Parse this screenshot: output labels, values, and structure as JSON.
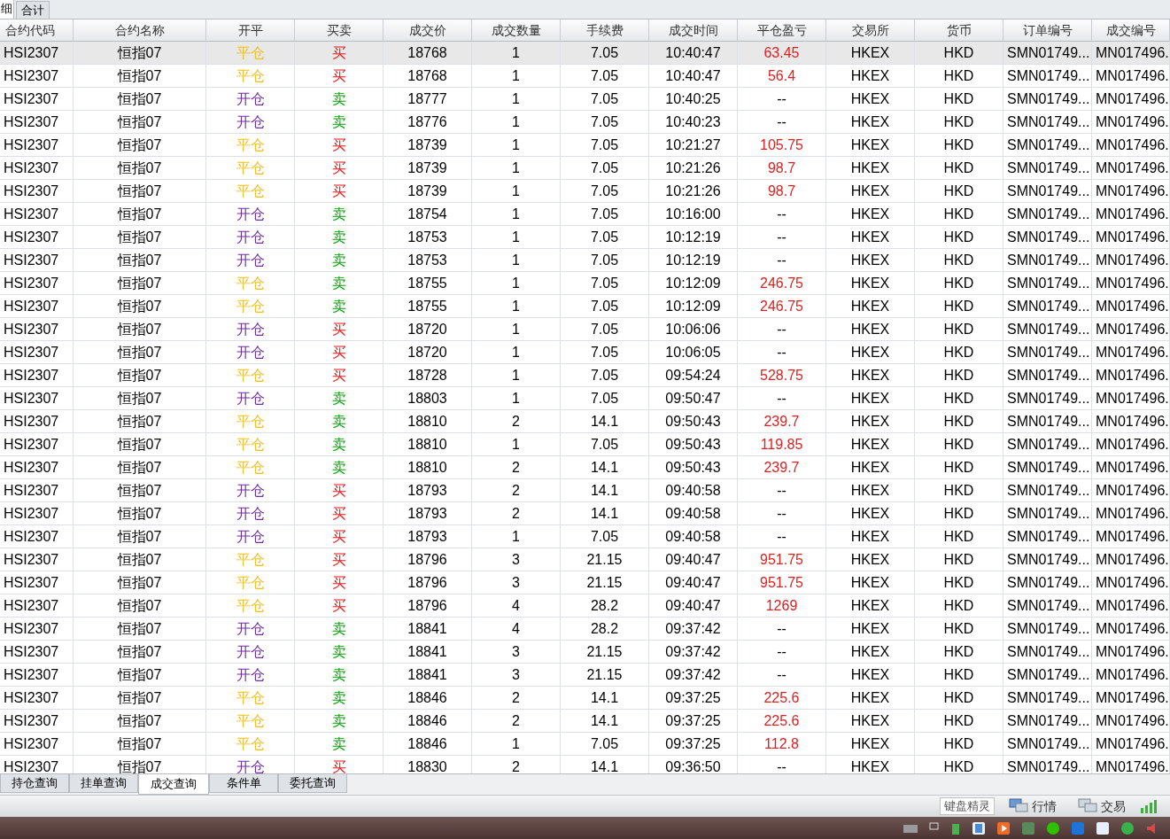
{
  "top_tabs": [
    {
      "label": "细",
      "selected": true
    },
    {
      "label": "合计",
      "selected": false
    }
  ],
  "table": {
    "columns": [
      "合约代码",
      "合约名称",
      "开平",
      "买卖",
      "成交价",
      "成交数量",
      "手续费",
      "成交时间",
      "平仓盈亏",
      "交易所",
      "货币",
      "订单编号",
      "成交编号"
    ],
    "rows": [
      {
        "selected": true,
        "code": "HSI2307",
        "name": "恒指07",
        "open_close": {
          "text": "平仓",
          "color": "#f0c020"
        },
        "side": {
          "text": "买",
          "color": "#e02020"
        },
        "price": "18768",
        "qty": "1",
        "fee": "7.05",
        "time": "10:40:47",
        "pnl": {
          "text": "63.45",
          "color": "#e02020"
        },
        "exchange": "HKEX",
        "currency": "HKD",
        "order_no": "SMN01749...",
        "trade_no": "MN017496."
      },
      {
        "selected": false,
        "code": "HSI2307",
        "name": "恒指07",
        "open_close": {
          "text": "平仓",
          "color": "#f0c020"
        },
        "side": {
          "text": "买",
          "color": "#e02020"
        },
        "price": "18768",
        "qty": "1",
        "fee": "7.05",
        "time": "10:40:47",
        "pnl": {
          "text": "56.4",
          "color": "#e02020"
        },
        "exchange": "HKEX",
        "currency": "HKD",
        "order_no": "SMN01749...",
        "trade_no": "MN017496."
      },
      {
        "selected": false,
        "code": "HSI2307",
        "name": "恒指07",
        "open_close": {
          "text": "开仓",
          "color": "#7030a0"
        },
        "side": {
          "text": "卖",
          "color": "#10a010"
        },
        "price": "18777",
        "qty": "1",
        "fee": "7.05",
        "time": "10:40:25",
        "pnl": {
          "text": "--",
          "color": "#000000"
        },
        "exchange": "HKEX",
        "currency": "HKD",
        "order_no": "SMN01749...",
        "trade_no": "MN017496."
      },
      {
        "selected": false,
        "code": "HSI2307",
        "name": "恒指07",
        "open_close": {
          "text": "开仓",
          "color": "#7030a0"
        },
        "side": {
          "text": "卖",
          "color": "#10a010"
        },
        "price": "18776",
        "qty": "1",
        "fee": "7.05",
        "time": "10:40:23",
        "pnl": {
          "text": "--",
          "color": "#000000"
        },
        "exchange": "HKEX",
        "currency": "HKD",
        "order_no": "SMN01749...",
        "trade_no": "MN017496."
      },
      {
        "selected": false,
        "code": "HSI2307",
        "name": "恒指07",
        "open_close": {
          "text": "平仓",
          "color": "#f0c020"
        },
        "side": {
          "text": "买",
          "color": "#e02020"
        },
        "price": "18739",
        "qty": "1",
        "fee": "7.05",
        "time": "10:21:27",
        "pnl": {
          "text": "105.75",
          "color": "#e02020"
        },
        "exchange": "HKEX",
        "currency": "HKD",
        "order_no": "SMN01749...",
        "trade_no": "MN017496."
      },
      {
        "selected": false,
        "code": "HSI2307",
        "name": "恒指07",
        "open_close": {
          "text": "平仓",
          "color": "#f0c020"
        },
        "side": {
          "text": "买",
          "color": "#e02020"
        },
        "price": "18739",
        "qty": "1",
        "fee": "7.05",
        "time": "10:21:26",
        "pnl": {
          "text": "98.7",
          "color": "#e02020"
        },
        "exchange": "HKEX",
        "currency": "HKD",
        "order_no": "SMN01749...",
        "trade_no": "MN017496."
      },
      {
        "selected": false,
        "code": "HSI2307",
        "name": "恒指07",
        "open_close": {
          "text": "平仓",
          "color": "#f0c020"
        },
        "side": {
          "text": "买",
          "color": "#e02020"
        },
        "price": "18739",
        "qty": "1",
        "fee": "7.05",
        "time": "10:21:26",
        "pnl": {
          "text": "98.7",
          "color": "#e02020"
        },
        "exchange": "HKEX",
        "currency": "HKD",
        "order_no": "SMN01749...",
        "trade_no": "MN017496."
      },
      {
        "selected": false,
        "code": "HSI2307",
        "name": "恒指07",
        "open_close": {
          "text": "开仓",
          "color": "#7030a0"
        },
        "side": {
          "text": "卖",
          "color": "#10a010"
        },
        "price": "18754",
        "qty": "1",
        "fee": "7.05",
        "time": "10:16:00",
        "pnl": {
          "text": "--",
          "color": "#000000"
        },
        "exchange": "HKEX",
        "currency": "HKD",
        "order_no": "SMN01749...",
        "trade_no": "MN017496."
      },
      {
        "selected": false,
        "code": "HSI2307",
        "name": "恒指07",
        "open_close": {
          "text": "开仓",
          "color": "#7030a0"
        },
        "side": {
          "text": "卖",
          "color": "#10a010"
        },
        "price": "18753",
        "qty": "1",
        "fee": "7.05",
        "time": "10:12:19",
        "pnl": {
          "text": "--",
          "color": "#000000"
        },
        "exchange": "HKEX",
        "currency": "HKD",
        "order_no": "SMN01749...",
        "trade_no": "MN017496."
      },
      {
        "selected": false,
        "code": "HSI2307",
        "name": "恒指07",
        "open_close": {
          "text": "开仓",
          "color": "#7030a0"
        },
        "side": {
          "text": "卖",
          "color": "#10a010"
        },
        "price": "18753",
        "qty": "1",
        "fee": "7.05",
        "time": "10:12:19",
        "pnl": {
          "text": "--",
          "color": "#000000"
        },
        "exchange": "HKEX",
        "currency": "HKD",
        "order_no": "SMN01749...",
        "trade_no": "MN017496."
      },
      {
        "selected": false,
        "code": "HSI2307",
        "name": "恒指07",
        "open_close": {
          "text": "平仓",
          "color": "#f0c020"
        },
        "side": {
          "text": "卖",
          "color": "#10a010"
        },
        "price": "18755",
        "qty": "1",
        "fee": "7.05",
        "time": "10:12:09",
        "pnl": {
          "text": "246.75",
          "color": "#e02020"
        },
        "exchange": "HKEX",
        "currency": "HKD",
        "order_no": "SMN01749...",
        "trade_no": "MN017496."
      },
      {
        "selected": false,
        "code": "HSI2307",
        "name": "恒指07",
        "open_close": {
          "text": "平仓",
          "color": "#f0c020"
        },
        "side": {
          "text": "卖",
          "color": "#10a010"
        },
        "price": "18755",
        "qty": "1",
        "fee": "7.05",
        "time": "10:12:09",
        "pnl": {
          "text": "246.75",
          "color": "#e02020"
        },
        "exchange": "HKEX",
        "currency": "HKD",
        "order_no": "SMN01749...",
        "trade_no": "MN017496."
      },
      {
        "selected": false,
        "code": "HSI2307",
        "name": "恒指07",
        "open_close": {
          "text": "开仓",
          "color": "#7030a0"
        },
        "side": {
          "text": "买",
          "color": "#e02020"
        },
        "price": "18720",
        "qty": "1",
        "fee": "7.05",
        "time": "10:06:06",
        "pnl": {
          "text": "--",
          "color": "#000000"
        },
        "exchange": "HKEX",
        "currency": "HKD",
        "order_no": "SMN01749...",
        "trade_no": "MN017496."
      },
      {
        "selected": false,
        "code": "HSI2307",
        "name": "恒指07",
        "open_close": {
          "text": "开仓",
          "color": "#7030a0"
        },
        "side": {
          "text": "买",
          "color": "#e02020"
        },
        "price": "18720",
        "qty": "1",
        "fee": "7.05",
        "time": "10:06:05",
        "pnl": {
          "text": "--",
          "color": "#000000"
        },
        "exchange": "HKEX",
        "currency": "HKD",
        "order_no": "SMN01749...",
        "trade_no": "MN017496."
      },
      {
        "selected": false,
        "code": "HSI2307",
        "name": "恒指07",
        "open_close": {
          "text": "平仓",
          "color": "#f0c020"
        },
        "side": {
          "text": "买",
          "color": "#e02020"
        },
        "price": "18728",
        "qty": "1",
        "fee": "7.05",
        "time": "09:54:24",
        "pnl": {
          "text": "528.75",
          "color": "#e02020"
        },
        "exchange": "HKEX",
        "currency": "HKD",
        "order_no": "SMN01749...",
        "trade_no": "MN017496."
      },
      {
        "selected": false,
        "code": "HSI2307",
        "name": "恒指07",
        "open_close": {
          "text": "开仓",
          "color": "#7030a0"
        },
        "side": {
          "text": "卖",
          "color": "#10a010"
        },
        "price": "18803",
        "qty": "1",
        "fee": "7.05",
        "time": "09:50:47",
        "pnl": {
          "text": "--",
          "color": "#000000"
        },
        "exchange": "HKEX",
        "currency": "HKD",
        "order_no": "SMN01749...",
        "trade_no": "MN017496."
      },
      {
        "selected": false,
        "code": "HSI2307",
        "name": "恒指07",
        "open_close": {
          "text": "平仓",
          "color": "#f0c020"
        },
        "side": {
          "text": "卖",
          "color": "#10a010"
        },
        "price": "18810",
        "qty": "2",
        "fee": "14.1",
        "time": "09:50:43",
        "pnl": {
          "text": "239.7",
          "color": "#e02020"
        },
        "exchange": "HKEX",
        "currency": "HKD",
        "order_no": "SMN01749...",
        "trade_no": "MN017496."
      },
      {
        "selected": false,
        "code": "HSI2307",
        "name": "恒指07",
        "open_close": {
          "text": "平仓",
          "color": "#f0c020"
        },
        "side": {
          "text": "卖",
          "color": "#10a010"
        },
        "price": "18810",
        "qty": "1",
        "fee": "7.05",
        "time": "09:50:43",
        "pnl": {
          "text": "119.85",
          "color": "#e02020"
        },
        "exchange": "HKEX",
        "currency": "HKD",
        "order_no": "SMN01749...",
        "trade_no": "MN017496."
      },
      {
        "selected": false,
        "code": "HSI2307",
        "name": "恒指07",
        "open_close": {
          "text": "平仓",
          "color": "#f0c020"
        },
        "side": {
          "text": "卖",
          "color": "#10a010"
        },
        "price": "18810",
        "qty": "2",
        "fee": "14.1",
        "time": "09:50:43",
        "pnl": {
          "text": "239.7",
          "color": "#e02020"
        },
        "exchange": "HKEX",
        "currency": "HKD",
        "order_no": "SMN01749...",
        "trade_no": "MN017496."
      },
      {
        "selected": false,
        "code": "HSI2307",
        "name": "恒指07",
        "open_close": {
          "text": "开仓",
          "color": "#7030a0"
        },
        "side": {
          "text": "买",
          "color": "#e02020"
        },
        "price": "18793",
        "qty": "2",
        "fee": "14.1",
        "time": "09:40:58",
        "pnl": {
          "text": "--",
          "color": "#000000"
        },
        "exchange": "HKEX",
        "currency": "HKD",
        "order_no": "SMN01749...",
        "trade_no": "MN017496."
      },
      {
        "selected": false,
        "code": "HSI2307",
        "name": "恒指07",
        "open_close": {
          "text": "开仓",
          "color": "#7030a0"
        },
        "side": {
          "text": "买",
          "color": "#e02020"
        },
        "price": "18793",
        "qty": "2",
        "fee": "14.1",
        "time": "09:40:58",
        "pnl": {
          "text": "--",
          "color": "#000000"
        },
        "exchange": "HKEX",
        "currency": "HKD",
        "order_no": "SMN01749...",
        "trade_no": "MN017496."
      },
      {
        "selected": false,
        "code": "HSI2307",
        "name": "恒指07",
        "open_close": {
          "text": "开仓",
          "color": "#7030a0"
        },
        "side": {
          "text": "买",
          "color": "#e02020"
        },
        "price": "18793",
        "qty": "1",
        "fee": "7.05",
        "time": "09:40:58",
        "pnl": {
          "text": "--",
          "color": "#000000"
        },
        "exchange": "HKEX",
        "currency": "HKD",
        "order_no": "SMN01749...",
        "trade_no": "MN017496."
      },
      {
        "selected": false,
        "code": "HSI2307",
        "name": "恒指07",
        "open_close": {
          "text": "平仓",
          "color": "#f0c020"
        },
        "side": {
          "text": "买",
          "color": "#e02020"
        },
        "price": "18796",
        "qty": "3",
        "fee": "21.15",
        "time": "09:40:47",
        "pnl": {
          "text": "951.75",
          "color": "#e02020"
        },
        "exchange": "HKEX",
        "currency": "HKD",
        "order_no": "SMN01749...",
        "trade_no": "MN017496."
      },
      {
        "selected": false,
        "code": "HSI2307",
        "name": "恒指07",
        "open_close": {
          "text": "平仓",
          "color": "#f0c020"
        },
        "side": {
          "text": "买",
          "color": "#e02020"
        },
        "price": "18796",
        "qty": "3",
        "fee": "21.15",
        "time": "09:40:47",
        "pnl": {
          "text": "951.75",
          "color": "#e02020"
        },
        "exchange": "HKEX",
        "currency": "HKD",
        "order_no": "SMN01749...",
        "trade_no": "MN017496."
      },
      {
        "selected": false,
        "code": "HSI2307",
        "name": "恒指07",
        "open_close": {
          "text": "平仓",
          "color": "#f0c020"
        },
        "side": {
          "text": "买",
          "color": "#e02020"
        },
        "price": "18796",
        "qty": "4",
        "fee": "28.2",
        "time": "09:40:47",
        "pnl": {
          "text": "1269",
          "color": "#e02020"
        },
        "exchange": "HKEX",
        "currency": "HKD",
        "order_no": "SMN01749...",
        "trade_no": "MN017496."
      },
      {
        "selected": false,
        "code": "HSI2307",
        "name": "恒指07",
        "open_close": {
          "text": "开仓",
          "color": "#7030a0"
        },
        "side": {
          "text": "卖",
          "color": "#10a010"
        },
        "price": "18841",
        "qty": "4",
        "fee": "28.2",
        "time": "09:37:42",
        "pnl": {
          "text": "--",
          "color": "#000000"
        },
        "exchange": "HKEX",
        "currency": "HKD",
        "order_no": "SMN01749...",
        "trade_no": "MN017496."
      },
      {
        "selected": false,
        "code": "HSI2307",
        "name": "恒指07",
        "open_close": {
          "text": "开仓",
          "color": "#7030a0"
        },
        "side": {
          "text": "卖",
          "color": "#10a010"
        },
        "price": "18841",
        "qty": "3",
        "fee": "21.15",
        "time": "09:37:42",
        "pnl": {
          "text": "--",
          "color": "#000000"
        },
        "exchange": "HKEX",
        "currency": "HKD",
        "order_no": "SMN01749...",
        "trade_no": "MN017496."
      },
      {
        "selected": false,
        "code": "HSI2307",
        "name": "恒指07",
        "open_close": {
          "text": "开仓",
          "color": "#7030a0"
        },
        "side": {
          "text": "卖",
          "color": "#10a010"
        },
        "price": "18841",
        "qty": "3",
        "fee": "21.15",
        "time": "09:37:42",
        "pnl": {
          "text": "--",
          "color": "#000000"
        },
        "exchange": "HKEX",
        "currency": "HKD",
        "order_no": "SMN01749...",
        "trade_no": "MN017496."
      },
      {
        "selected": false,
        "code": "HSI2307",
        "name": "恒指07",
        "open_close": {
          "text": "平仓",
          "color": "#f0c020"
        },
        "side": {
          "text": "卖",
          "color": "#10a010"
        },
        "price": "18846",
        "qty": "2",
        "fee": "14.1",
        "time": "09:37:25",
        "pnl": {
          "text": "225.6",
          "color": "#e02020"
        },
        "exchange": "HKEX",
        "currency": "HKD",
        "order_no": "SMN01749...",
        "trade_no": "MN017496."
      },
      {
        "selected": false,
        "code": "HSI2307",
        "name": "恒指07",
        "open_close": {
          "text": "平仓",
          "color": "#f0c020"
        },
        "side": {
          "text": "卖",
          "color": "#10a010"
        },
        "price": "18846",
        "qty": "2",
        "fee": "14.1",
        "time": "09:37:25",
        "pnl": {
          "text": "225.6",
          "color": "#e02020"
        },
        "exchange": "HKEX",
        "currency": "HKD",
        "order_no": "SMN01749...",
        "trade_no": "MN017496."
      },
      {
        "selected": false,
        "code": "HSI2307",
        "name": "恒指07",
        "open_close": {
          "text": "平仓",
          "color": "#f0c020"
        },
        "side": {
          "text": "卖",
          "color": "#10a010"
        },
        "price": "18846",
        "qty": "1",
        "fee": "7.05",
        "time": "09:37:25",
        "pnl": {
          "text": "112.8",
          "color": "#e02020"
        },
        "exchange": "HKEX",
        "currency": "HKD",
        "order_no": "SMN01749...",
        "trade_no": "MN017496."
      },
      {
        "selected": false,
        "code": "HSI2307",
        "name": "恒指07",
        "open_close": {
          "text": "开仓",
          "color": "#7030a0"
        },
        "side": {
          "text": "买",
          "color": "#e02020"
        },
        "price": "18830",
        "qty": "2",
        "fee": "14.1",
        "time": "09:36:50",
        "pnl": {
          "text": "--",
          "color": "#000000"
        },
        "exchange": "HKEX",
        "currency": "HKD",
        "order_no": "SMN01749...",
        "trade_no": "MN017496."
      }
    ]
  },
  "bottom_tabs": [
    {
      "label": "持仓查询",
      "selected": false
    },
    {
      "label": "挂单查询",
      "selected": false
    },
    {
      "label": "成交查询",
      "selected": true
    },
    {
      "label": "条件单",
      "selected": false
    },
    {
      "label": "委托查询",
      "selected": false
    }
  ],
  "status_bar": {
    "keyboard_wizard": "键盘精灵",
    "quotes": "行情",
    "trading": "交易"
  }
}
